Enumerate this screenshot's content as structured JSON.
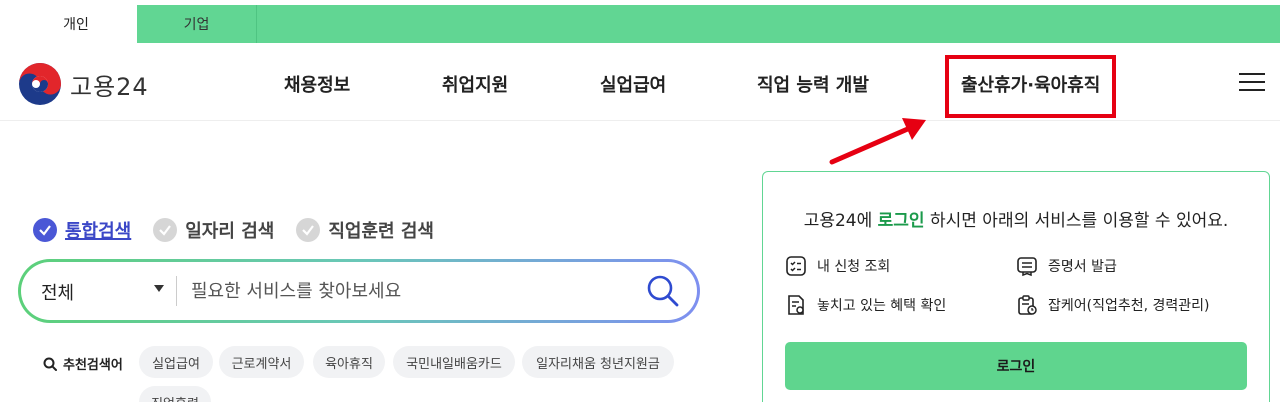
{
  "audience_tabs": [
    {
      "label": "개인",
      "active": true
    },
    {
      "label": "기업",
      "active": false
    }
  ],
  "logo": {
    "text": "고용24",
    "icon": "taegeuk-logo-icon"
  },
  "nav": {
    "items": [
      {
        "label": "채용정보"
      },
      {
        "label": "취업지원"
      },
      {
        "label": "실업급여"
      },
      {
        "label": "직업 능력 개발"
      },
      {
        "label": "출산휴가·육아휴직",
        "highlighted": true
      }
    ],
    "menu_icon": "hamburger-menu-icon"
  },
  "search": {
    "types": [
      {
        "label": "통합검색",
        "selected": true
      },
      {
        "label": "일자리 검색",
        "selected": false
      },
      {
        "label": "직업훈련 검색",
        "selected": false
      }
    ],
    "scope_value": "전체",
    "placeholder": "필요한 서비스를 찾아보세요",
    "search_icon": "search-icon"
  },
  "recommended": {
    "title": "추천검색어",
    "keywords": [
      "실업급여",
      "근로계약서",
      "육아휴직",
      "국민내일배움카드",
      "일자리채움 청년지원금",
      "직업훈련"
    ]
  },
  "login_panel": {
    "message_pre": "고용24에 ",
    "message_link": "로그인",
    "message_post": " 하시면 아래의 서비스를 이용할 수 있어요.",
    "services": [
      {
        "label": "내 신청 조회",
        "icon": "checklist-icon"
      },
      {
        "label": "증명서 발급",
        "icon": "certificate-icon"
      },
      {
        "label": "놓치고 있는 혜택 확인",
        "icon": "benefit-document-icon"
      },
      {
        "label": "잡케어(직업추천, 경력관리)",
        "icon": "jobcare-clipboard-icon"
      }
    ],
    "button_label": "로그인"
  },
  "colors": {
    "brand_green": "#61d693",
    "highlight_red": "#e60012",
    "selected_blue": "#4a57d6"
  }
}
